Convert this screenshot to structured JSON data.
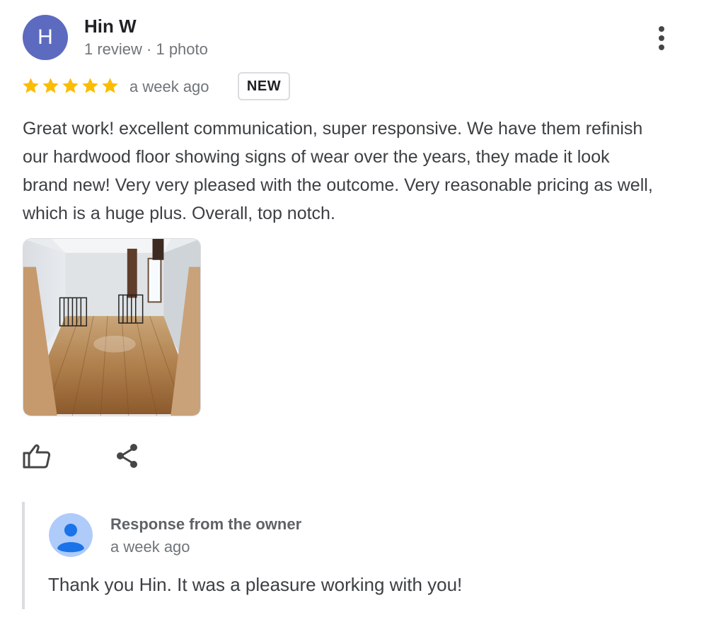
{
  "review": {
    "reviewer": {
      "initial": "H",
      "name": "Hin W",
      "meta": "1 review · 1 photo",
      "avatar_color": "#5c6bc0"
    },
    "rating": 5,
    "rating_max": 5,
    "star_color": "#fbbc04",
    "time": "a week ago",
    "badge": "NEW",
    "text": "Great work! excellent communication, super responsive. We have them refinish our hardwood floor showing signs of wear over the years, they made it look brand new! Very very pleased with the outcome. Very reasonable pricing as well, which is a huge plus. Overall, top notch.",
    "photo_count": 1,
    "icons": {
      "more": "more-vert-icon",
      "like": "thumbs-up-icon",
      "share": "share-icon"
    }
  },
  "owner_response": {
    "title": "Response from the owner",
    "time": "a week ago",
    "text": "Thank you Hin. It was a pleasure working with you!",
    "avatar_color": "#aecbfa",
    "avatar_figure_color": "#1a73e8"
  }
}
